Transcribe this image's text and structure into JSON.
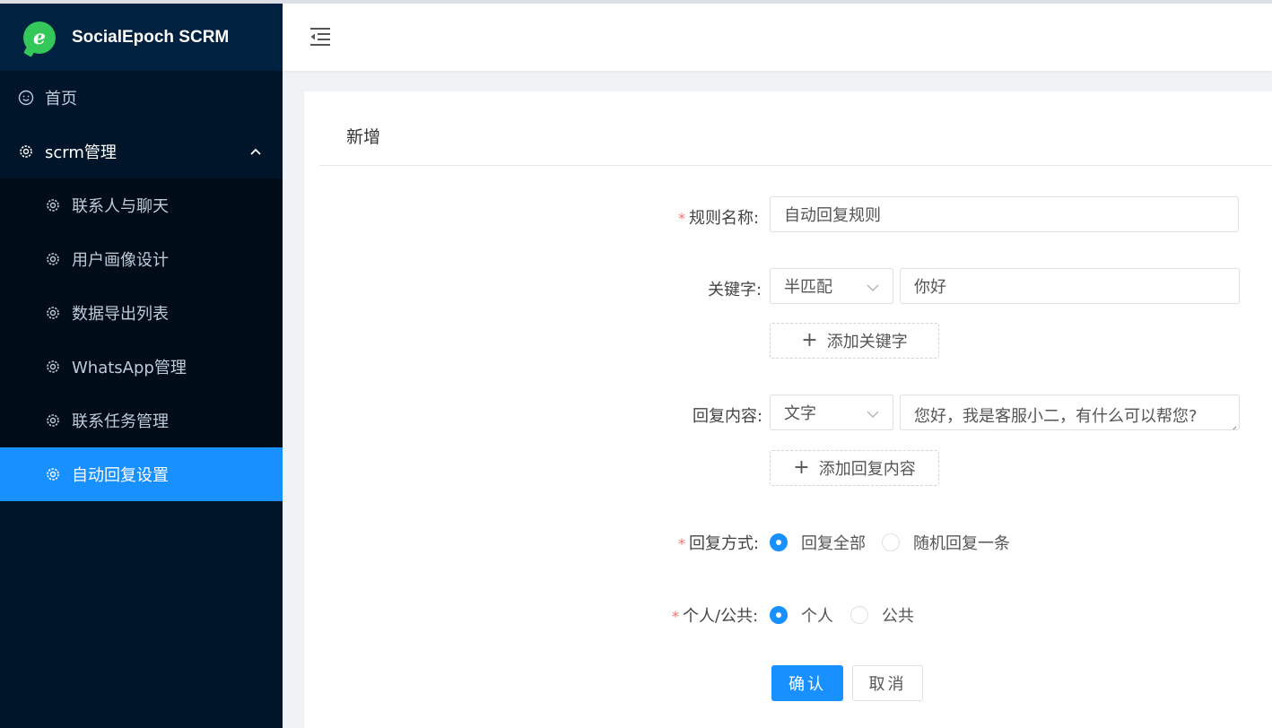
{
  "app": {
    "title": "SocialEpoch SCRM",
    "logo_letter": "e"
  },
  "sidebar": {
    "home_label": "首页",
    "group_label": "scrm管理",
    "items": [
      {
        "label": "联系人与聊天"
      },
      {
        "label": "用户画像设计"
      },
      {
        "label": "数据导出列表"
      },
      {
        "label": "WhatsApp管理"
      },
      {
        "label": "联系任务管理"
      },
      {
        "label": "自动回复设置"
      }
    ]
  },
  "page": {
    "title": "新增"
  },
  "form": {
    "required_mark": "*",
    "rule_name": {
      "label": "规则名称:",
      "value": "自动回复规则"
    },
    "keyword": {
      "label": "关键字:",
      "match_type": "半匹配",
      "value": "你好",
      "add_label": "添加关键字"
    },
    "reply": {
      "label": "回复内容:",
      "type": "文字",
      "value": "您好，我是客服小二，有什么可以帮您?",
      "add_label": "添加回复内容"
    },
    "reply_mode": {
      "label": "回复方式:",
      "options": [
        "回复全部",
        "随机回复一条"
      ],
      "selected": "回复全部"
    },
    "scope": {
      "label": "个人/公共:",
      "options": [
        "个人",
        "公共"
      ],
      "selected": "个人"
    },
    "confirm_label": "确认",
    "cancel_label": "取消"
  },
  "colors": {
    "accent": "#1890ff",
    "sidebar_bg": "#001529",
    "required": "#f56c6c"
  }
}
